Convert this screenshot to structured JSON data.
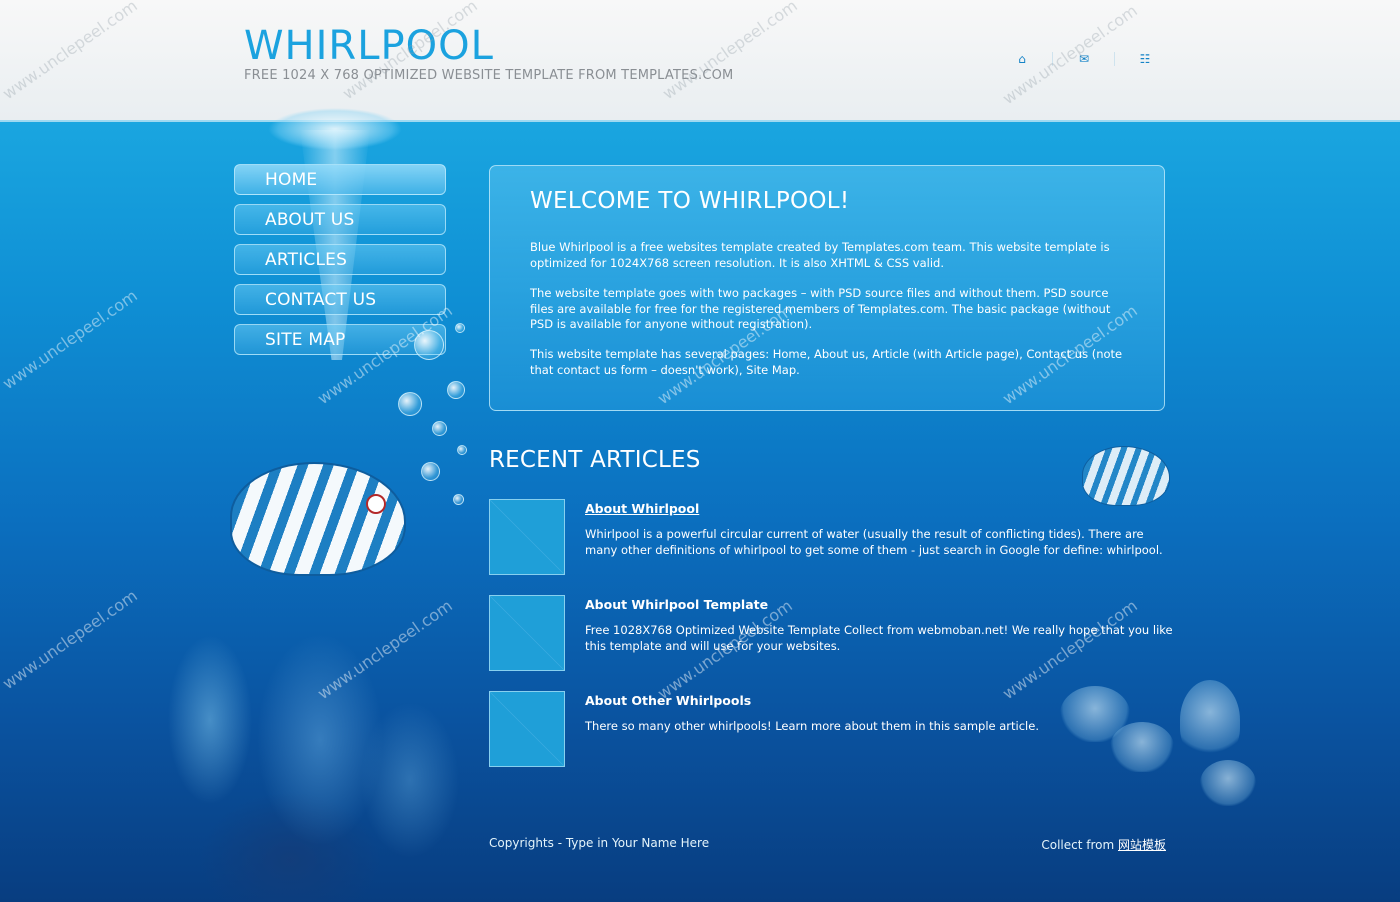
{
  "header": {
    "logo_title": "WHIRLPOOL",
    "tagline": "FREE 1024 X 768 OPTIMIZED WEBSITE TEMPLATE FROM TEMPLATES.COM",
    "icons": [
      "home-icon",
      "mail-icon",
      "sitemap-icon"
    ]
  },
  "nav": {
    "items": [
      {
        "label": "HOME"
      },
      {
        "label": "ABOUT US"
      },
      {
        "label": "ARTICLES"
      },
      {
        "label": "CONTACT US"
      },
      {
        "label": "SITE MAP"
      }
    ]
  },
  "welcome": {
    "title": "WELCOME TO WHIRLPOOL!",
    "paragraphs": [
      "Blue Whirlpool is a free websites template created by Templates.com team. This website template is optimized for 1024X768 screen resolution. It is also XHTML & CSS valid.",
      "The website template goes with two packages – with PSD source files and without them. PSD source files are available for free for the registered members of Templates.com. The basic package (without PSD is available for anyone without registration).",
      "This website template has several pages: Home, About us, Article (with Article page), Contact us (note that contact us form – doesn't work), Site Map."
    ]
  },
  "recent": {
    "title": "RECENT ARTICLES",
    "articles": [
      {
        "title": "About Whirlpool",
        "text": "Whirlpool is a powerful circular current of water (usually the result of conflicting tides). There are many other definitions of whirlpool to get some of them - just search in Google for define: whirlpool."
      },
      {
        "title": "About Whirlpool Template",
        "text": "Free 1028X768 Optimized Website Template Collect from webmoban.net! We really hope that you like this template and will use for your websites."
      },
      {
        "title": "About Other Whirlpools",
        "text": "There so many other whirlpools! Learn more about them in this sample article."
      }
    ]
  },
  "footer": {
    "copyright": "Copyrights - Type in Your Name Here",
    "collect_prefix": "Collect from ",
    "collect_link": "网站模板"
  },
  "watermark": "www.unclepeel.com",
  "colors": {
    "accent": "#1ba2df",
    "header_bg": "#f3f5f6",
    "ocean_top": "#2cbff0",
    "ocean_bottom": "#083d80"
  }
}
